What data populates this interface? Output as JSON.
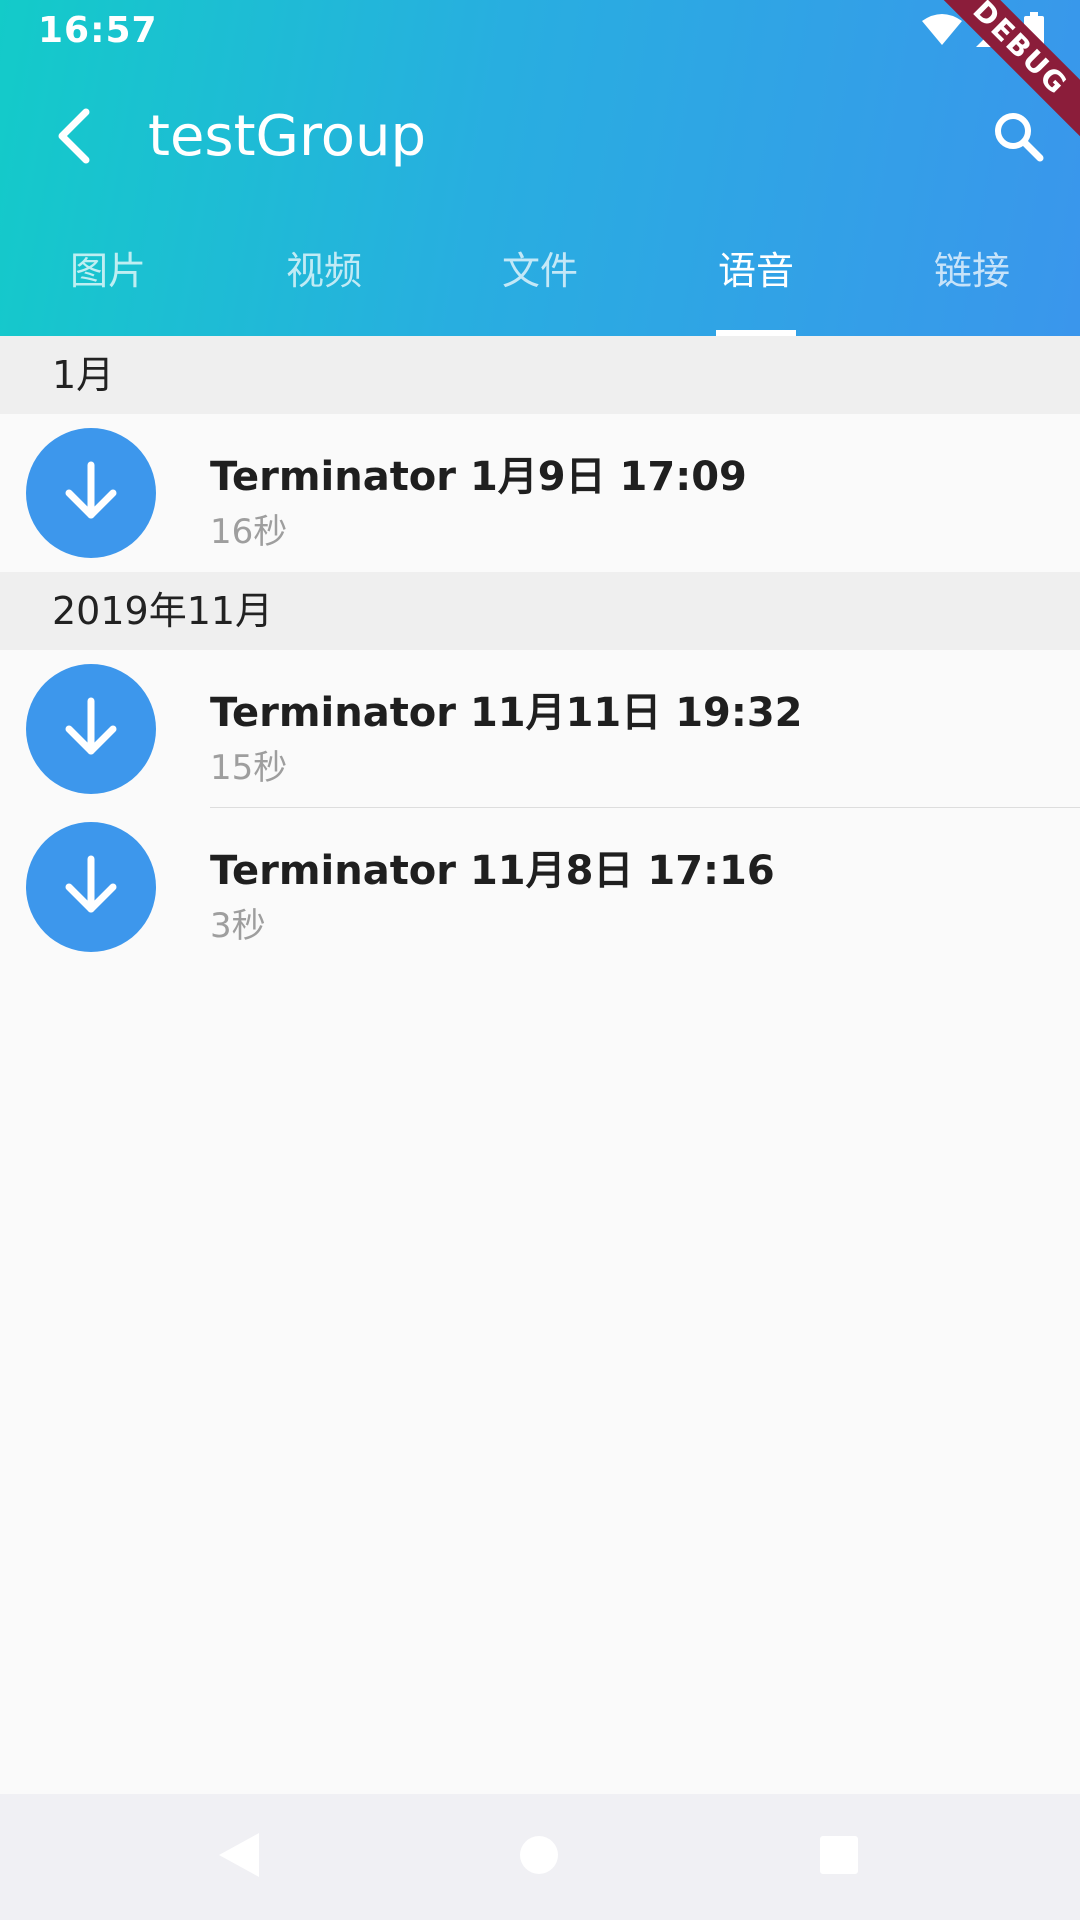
{
  "status_bar": {
    "time": "16:57",
    "icons": [
      "wifi-icon",
      "signal-icon",
      "battery-icon"
    ],
    "debug_banner": "DEBUG"
  },
  "toolbar": {
    "title": "testGroup",
    "back_icon": "back-arrow-icon",
    "search_icon": "search-icon"
  },
  "tabs": [
    {
      "label": "图片",
      "active": false
    },
    {
      "label": "视频",
      "active": false
    },
    {
      "label": "文件",
      "active": false
    },
    {
      "label": "语音",
      "active": true
    },
    {
      "label": "链接",
      "active": false
    }
  ],
  "sections": [
    {
      "header": "1月",
      "items": [
        {
          "title": "Terminator 1月9日 17:09",
          "duration": "16秒",
          "icon": "download-icon"
        }
      ]
    },
    {
      "header": "2019年11月",
      "items": [
        {
          "title": "Terminator 11月11日 19:32",
          "duration": "15秒",
          "icon": "download-icon"
        },
        {
          "title": "Terminator 11月8日 17:16",
          "duration": "3秒",
          "icon": "download-icon"
        }
      ]
    }
  ],
  "colors": {
    "appbar_start": "#13cbc9",
    "appbar_end": "#3a96ec",
    "accent": "#3d97ec",
    "debug_ribbon": "#8b1d3a"
  },
  "navbar": {
    "icons": [
      "nav-back-icon",
      "nav-home-icon",
      "nav-recents-icon"
    ]
  }
}
